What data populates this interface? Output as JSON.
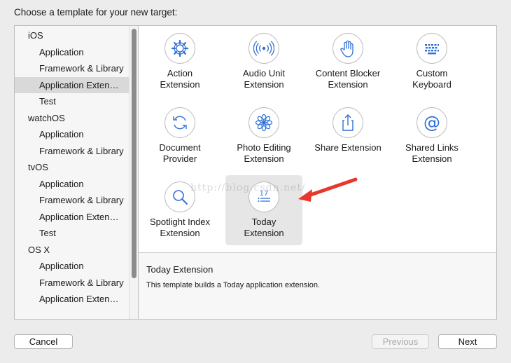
{
  "dialog": {
    "heading": "Choose a template for your new target:"
  },
  "sidebar": {
    "rows": [
      {
        "kind": "group",
        "label": "iOS"
      },
      {
        "kind": "item",
        "label": "Application"
      },
      {
        "kind": "item",
        "label": "Framework & Library"
      },
      {
        "kind": "item",
        "label": "Application Exten…",
        "selected": true
      },
      {
        "kind": "item",
        "label": "Test"
      },
      {
        "kind": "group",
        "label": "watchOS"
      },
      {
        "kind": "item",
        "label": "Application"
      },
      {
        "kind": "item",
        "label": "Framework & Library"
      },
      {
        "kind": "group",
        "label": "tvOS"
      },
      {
        "kind": "item",
        "label": "Application"
      },
      {
        "kind": "item",
        "label": "Framework & Library"
      },
      {
        "kind": "item",
        "label": "Application Exten…"
      },
      {
        "kind": "item",
        "label": "Test"
      },
      {
        "kind": "group",
        "label": "OS X"
      },
      {
        "kind": "item",
        "label": "Application"
      },
      {
        "kind": "item",
        "label": "Framework & Library"
      },
      {
        "kind": "item",
        "label": "Application Exten…"
      }
    ]
  },
  "templates": [
    {
      "line1": "Action",
      "line2": "Extension",
      "icon": "gear-icon"
    },
    {
      "line1": "Audio Unit",
      "line2": "Extension",
      "icon": "audio-waves-icon"
    },
    {
      "line1": "Content Blocker",
      "line2": "Extension",
      "icon": "hand-icon"
    },
    {
      "line1": "Custom",
      "line2": "Keyboard",
      "icon": "keyboard-icon"
    },
    {
      "line1": "Document",
      "line2": "Provider",
      "icon": "refresh-arrows-icon"
    },
    {
      "line1": "Photo Editing",
      "line2": "Extension",
      "icon": "flower-icon"
    },
    {
      "line1": "Share Extension",
      "line2": "",
      "icon": "share-icon"
    },
    {
      "line1": "Shared Links",
      "line2": "Extension",
      "icon": "at-sign-icon"
    },
    {
      "line1": "Spotlight Index",
      "line2": "Extension",
      "icon": "magnifier-icon"
    },
    {
      "line1": "Today",
      "line2": "Extension",
      "icon": "today-calendar-icon",
      "selected": true
    }
  ],
  "description": {
    "title": "Today Extension",
    "text": "This template builds a Today application extension."
  },
  "buttons": {
    "cancel": "Cancel",
    "previous": "Previous",
    "next": "Next"
  },
  "watermark": "http://blog.csdn.net/",
  "colors": {
    "selection": "#d9d9d9",
    "icon_stroke": "#2f6fd6",
    "annotation_arrow": "#e8372c"
  }
}
